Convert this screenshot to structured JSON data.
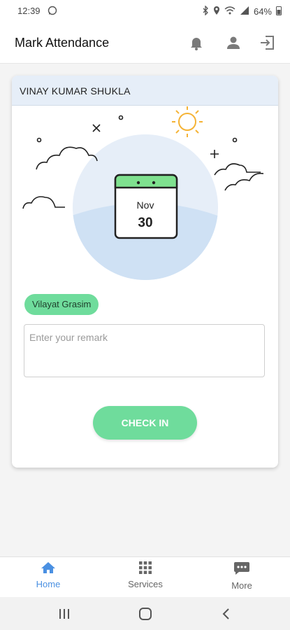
{
  "status": {
    "time": "12:39",
    "battery": "64%"
  },
  "appbar": {
    "title": "Mark Attendance",
    "icons": [
      "bell-icon",
      "user-icon",
      "logout-icon"
    ]
  },
  "card": {
    "user_name": "VINAY KUMAR SHUKLA",
    "date_month": "Nov",
    "date_day": "30",
    "location_chip": "Vilayat Grasim",
    "remark_placeholder": "Enter your remark",
    "checkin_label": "CHECK IN"
  },
  "bottom_nav": {
    "items": [
      {
        "label": "Home",
        "icon": "home-icon",
        "active": true
      },
      {
        "label": "Services",
        "icon": "grid-icon",
        "active": false
      },
      {
        "label": "More",
        "icon": "more-icon",
        "active": false
      }
    ]
  },
  "colors": {
    "accent_green": "#6fdc9c",
    "active_blue": "#4a90e2",
    "header_bg": "#e6eef8"
  }
}
